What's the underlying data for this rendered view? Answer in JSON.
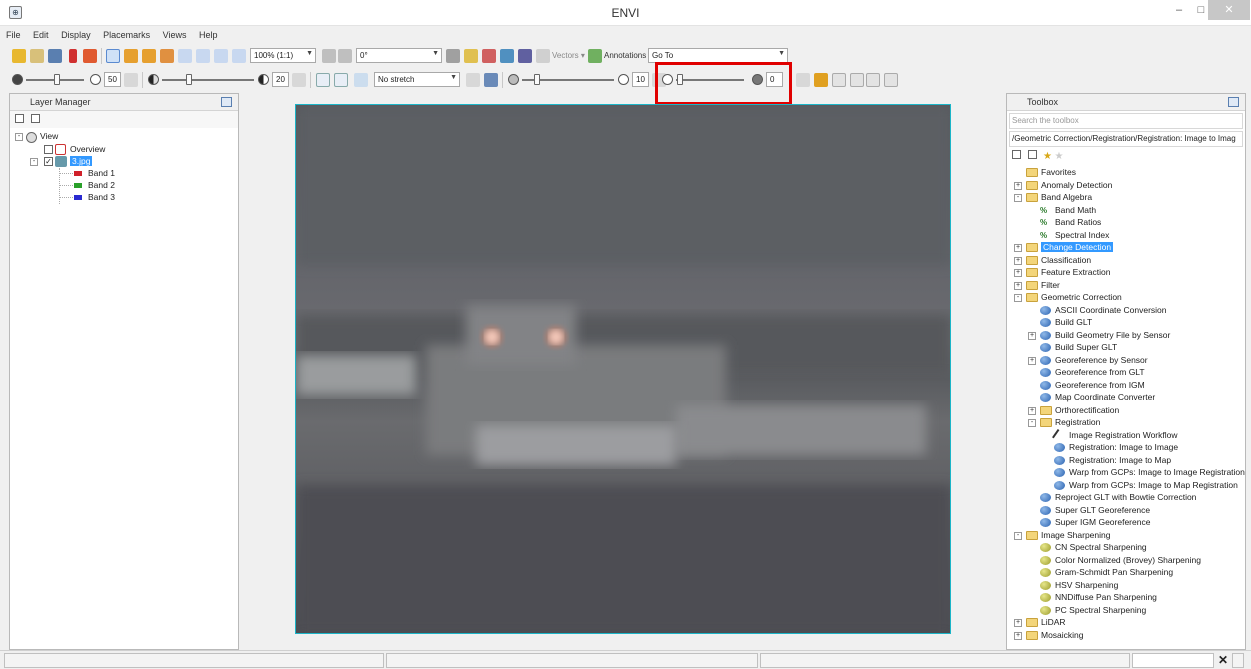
{
  "window": {
    "title": "ENVI",
    "icon": "envi-app-icon",
    "controls": [
      "minimize",
      "maximize",
      "close"
    ]
  },
  "menu": [
    "File",
    "Edit",
    "Display",
    "Placemarks",
    "Views",
    "Help"
  ],
  "toolbar1": {
    "zoom": "100% (1:1)",
    "rotation": "0°",
    "vectors": "Vectors",
    "annotations": "Annotations",
    "goto": "Go To"
  },
  "toolbar2": {
    "brightness": "50",
    "contrast": "20",
    "stretch": "No stretch",
    "sharpen": "10",
    "transparency": "0"
  },
  "layer_manager": {
    "title": "Layer Manager",
    "tree": {
      "view": "View",
      "overview": "Overview",
      "file": "3.jpg",
      "bands": [
        "Band 1",
        "Band 2",
        "Band 3"
      ]
    },
    "band_colors": [
      "#d0202a",
      "#2aa02a",
      "#2a2ad0"
    ]
  },
  "toolbox": {
    "title": "Toolbox",
    "search_placeholder": "Search the toolbox",
    "path": "/Geometric Correction/Registration/Registration: Image to Imag",
    "items": [
      {
        "label": "Favorites",
        "type": "folder",
        "level": 0,
        "exp": ""
      },
      {
        "label": "Anomaly Detection",
        "type": "folder",
        "level": 0,
        "exp": "+"
      },
      {
        "label": "Band Algebra",
        "type": "folder",
        "level": 0,
        "exp": "-"
      },
      {
        "label": "Band Math",
        "type": "math",
        "level": 1,
        "exp": ""
      },
      {
        "label": "Band Ratios",
        "type": "math",
        "level": 1,
        "exp": ""
      },
      {
        "label": "Spectral Index",
        "type": "math",
        "level": 1,
        "exp": ""
      },
      {
        "label": "Change Detection",
        "type": "folder",
        "level": 0,
        "exp": "+",
        "selected": true
      },
      {
        "label": "Classification",
        "type": "folder",
        "level": 0,
        "exp": "+"
      },
      {
        "label": "Feature Extraction",
        "type": "folder",
        "level": 0,
        "exp": "+"
      },
      {
        "label": "Filter",
        "type": "folder",
        "level": 0,
        "exp": "+"
      },
      {
        "label": "Geometric Correction",
        "type": "folder",
        "level": 0,
        "exp": "-"
      },
      {
        "label": "ASCII Coordinate Conversion",
        "type": "tool",
        "level": 1,
        "exp": ""
      },
      {
        "label": "Build GLT",
        "type": "tool",
        "level": 1,
        "exp": ""
      },
      {
        "label": "Build Geometry File by Sensor",
        "type": "tool",
        "level": 1,
        "exp": "+"
      },
      {
        "label": "Build Super GLT",
        "type": "tool",
        "level": 1,
        "exp": ""
      },
      {
        "label": "Georeference by Sensor",
        "type": "tool",
        "level": 1,
        "exp": "+"
      },
      {
        "label": "Georeference from GLT",
        "type": "tool",
        "level": 1,
        "exp": ""
      },
      {
        "label": "Georeference from IGM",
        "type": "tool",
        "level": 1,
        "exp": ""
      },
      {
        "label": "Map Coordinate Converter",
        "type": "tool",
        "level": 1,
        "exp": ""
      },
      {
        "label": "Orthorectification",
        "type": "folder",
        "level": 1,
        "exp": "+"
      },
      {
        "label": "Registration",
        "type": "folder",
        "level": 1,
        "exp": "-"
      },
      {
        "label": "Image Registration Workflow",
        "type": "wizard",
        "level": 2,
        "exp": ""
      },
      {
        "label": "Registration: Image to Image",
        "type": "tool",
        "level": 2,
        "exp": ""
      },
      {
        "label": "Registration: Image to Map",
        "type": "tool",
        "level": 2,
        "exp": ""
      },
      {
        "label": "Warp from GCPs: Image to Image Registration",
        "type": "tool",
        "level": 2,
        "exp": ""
      },
      {
        "label": "Warp from GCPs: Image to Map Registration",
        "type": "tool",
        "level": 2,
        "exp": ""
      },
      {
        "label": "Reproject GLT with Bowtie Correction",
        "type": "tool",
        "level": 1,
        "exp": ""
      },
      {
        "label": "Super GLT Georeference",
        "type": "tool",
        "level": 1,
        "exp": ""
      },
      {
        "label": "Super IGM Georeference",
        "type": "tool",
        "level": 1,
        "exp": ""
      },
      {
        "label": "Image Sharpening",
        "type": "folder",
        "level": 0,
        "exp": "-"
      },
      {
        "label": "CN Spectral Sharpening",
        "type": "sharp",
        "level": 1,
        "exp": ""
      },
      {
        "label": "Color Normalized (Brovey) Sharpening",
        "type": "sharp",
        "level": 1,
        "exp": ""
      },
      {
        "label": "Gram-Schmidt Pan Sharpening",
        "type": "sharp",
        "level": 1,
        "exp": ""
      },
      {
        "label": "HSV Sharpening",
        "type": "sharp",
        "level": 1,
        "exp": ""
      },
      {
        "label": "NNDiffuse Pan Sharpening",
        "type": "sharp",
        "level": 1,
        "exp": ""
      },
      {
        "label": "PC Spectral Sharpening",
        "type": "sharp",
        "level": 1,
        "exp": ""
      },
      {
        "label": "LiDAR",
        "type": "folder",
        "level": 0,
        "exp": "+"
      },
      {
        "label": "Mosaicking",
        "type": "folder",
        "level": 0,
        "exp": "+"
      }
    ]
  },
  "highlight_color": "#e00000"
}
